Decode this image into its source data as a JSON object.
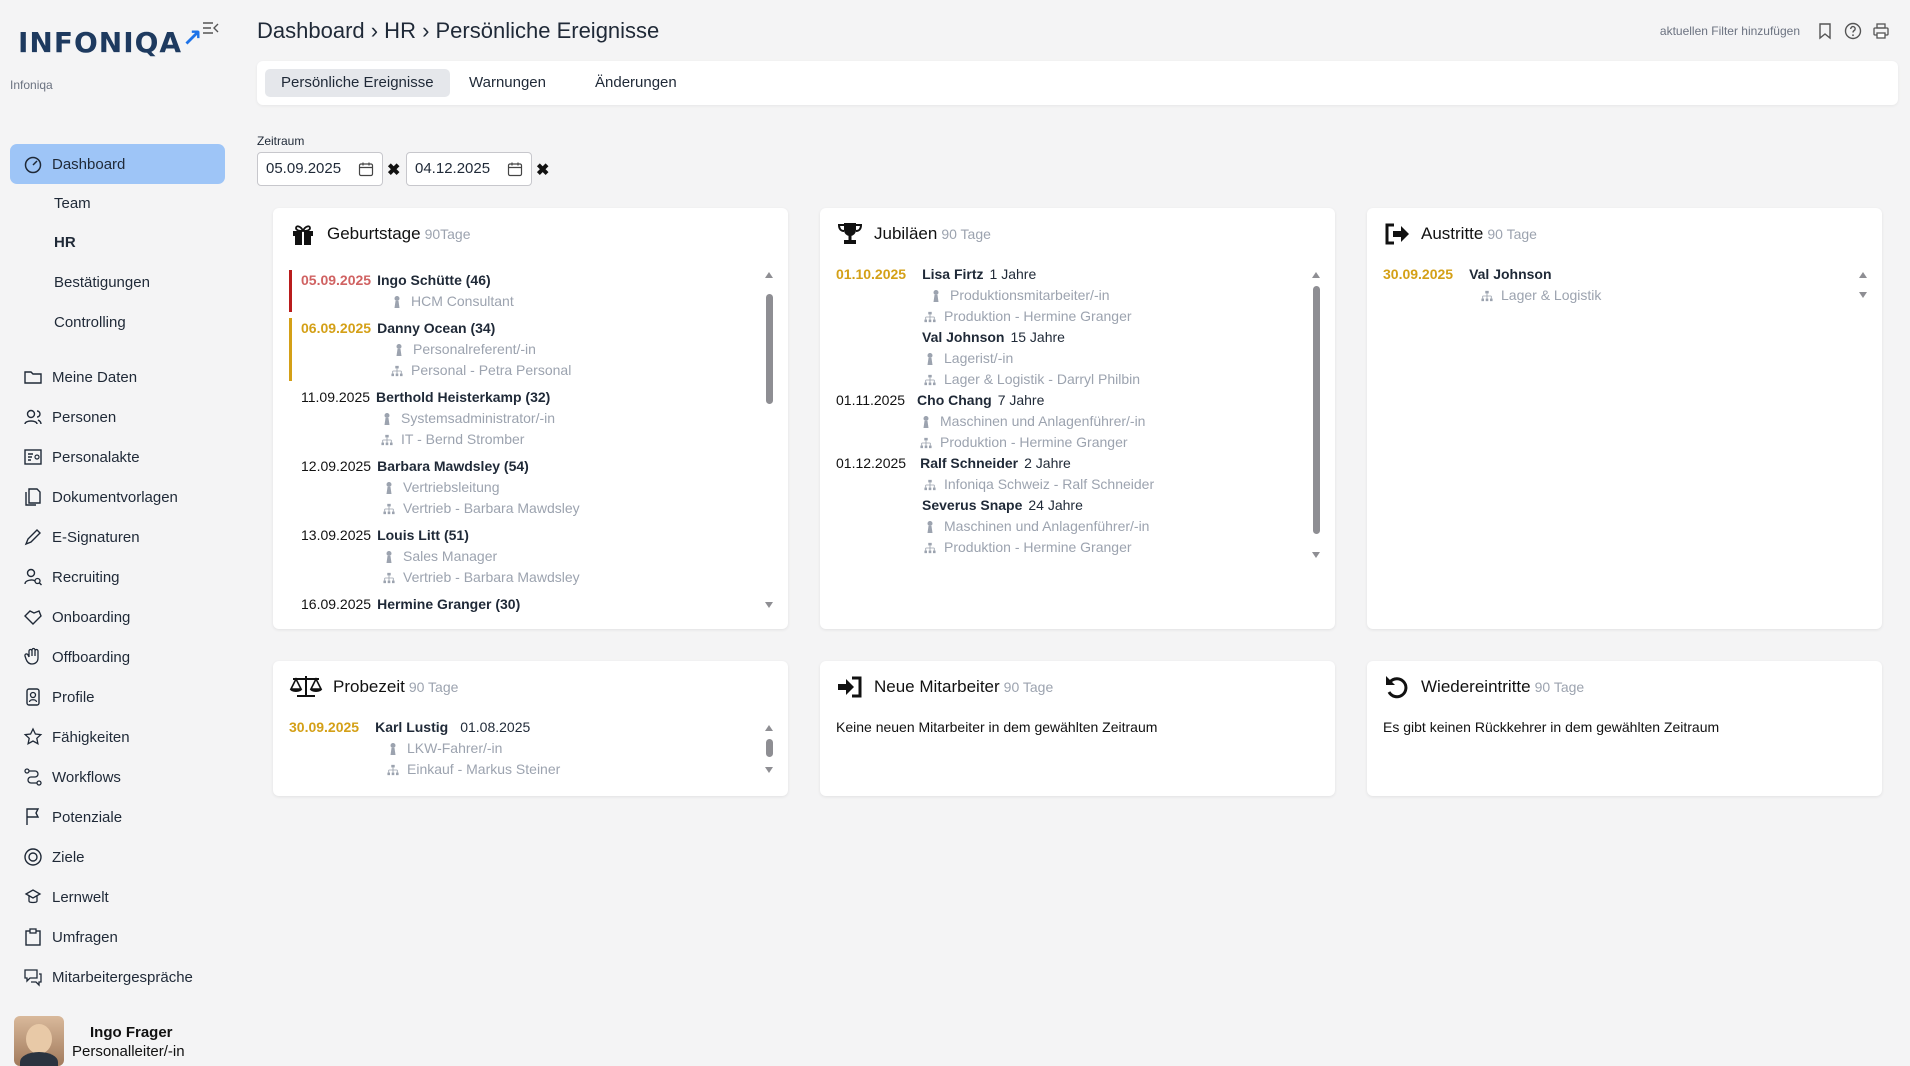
{
  "brand": {
    "logo_text": "INFONIQA",
    "tenant": "Infoniqa"
  },
  "breadcrumb": "Dashboard › HR › Persönliche Ereignisse",
  "header_actions": {
    "filter_label": "aktuellen Filter hinzufügen"
  },
  "sidebar": {
    "dashboard": "Dashboard",
    "sub": [
      "Team",
      "HR",
      "Bestätigungen",
      "Controlling"
    ],
    "items": [
      "Meine Daten",
      "Personen",
      "Personalakte",
      "Dokumentvorlagen",
      "E-Signaturen",
      "Recruiting",
      "Onboarding",
      "Offboarding",
      "Profile",
      "Fähigkeiten",
      "Workflows",
      "Potenziale",
      "Ziele",
      "Lernwelt",
      "Umfragen",
      "Mitarbeitergespräche"
    ]
  },
  "user": {
    "name": "Ingo Frager",
    "role": "Personalleiter/-in"
  },
  "tabs": [
    "Persönliche Ereignisse",
    "Warnungen",
    "Änderungen"
  ],
  "range": {
    "label": "Zeitraum",
    "from": "05.09.2025",
    "to": "04.12.2025"
  },
  "cards": {
    "birthdays": {
      "title": "Geburtstage",
      "sub": "90Tage",
      "entries": [
        {
          "date": "05.09.2025",
          "name": "Ingo Schütte (46)",
          "position": "HCM Consultant",
          "org": ""
        },
        {
          "date": "06.09.2025",
          "name": "Danny Ocean (34)",
          "position": "Personalreferent/-in",
          "org": "Personal - Petra Personal"
        },
        {
          "date": "11.09.2025",
          "name": "Berthold Heisterkamp (32)",
          "position": "Systemsadministrator/-in",
          "org": "IT - Bernd Stromber"
        },
        {
          "date": "12.09.2025",
          "name": "Barbara Mawdsley (54)",
          "position": "Vertriebsleitung",
          "org": "Vertrieb - Barbara Mawdsley"
        },
        {
          "date": "13.09.2025",
          "name": "Louis Litt (51)",
          "position": "Sales Manager",
          "org": "Vertrieb - Barbara Mawdsley"
        },
        {
          "date": "16.09.2025",
          "name": "Hermine Granger (30)",
          "position": "",
          "org": ""
        }
      ]
    },
    "jubilees": {
      "title": "Jubiläen",
      "sub": "90 Tage",
      "entries": [
        {
          "date": "01.10.2025",
          "name": "Lisa Firtz",
          "years": "1 Jahre",
          "position": "Produktionsmitarbeiter/-in",
          "org": "Produktion - Hermine Granger"
        },
        {
          "date": "",
          "name": "Val Johnson",
          "years": "15 Jahre",
          "position": "Lagerist/-in",
          "org": "Lager & Logistik - Darryl Philbin"
        },
        {
          "date": "01.11.2025",
          "name": "Cho Chang",
          "years": "7 Jahre",
          "position": "Maschinen und Anlagenführer/-in",
          "org": "Produktion - Hermine Granger"
        },
        {
          "date": "01.12.2025",
          "name": "Ralf Schneider",
          "years": "2 Jahre",
          "position": "",
          "org": "Infoniqa Schweiz - Ralf Schneider"
        },
        {
          "date": "",
          "name": "Severus Snape",
          "years": "24 Jahre",
          "position": "Maschinen und Anlagenführer/-in",
          "org": "Produktion - Hermine Granger"
        }
      ]
    },
    "exits": {
      "title": "Austritte",
      "sub": "90 Tage",
      "entries": [
        {
          "date": "30.09.2025",
          "name": "Val Johnson",
          "org": "Lager & Logistik"
        }
      ]
    },
    "probation": {
      "title": "Probezeit",
      "sub": "90 Tage",
      "entries": [
        {
          "date": "30.09.2025",
          "name": "Karl Lustig",
          "start": "01.08.2025",
          "position": "LKW-Fahrer/-in",
          "org": "Einkauf - Markus Steiner"
        }
      ]
    },
    "new_hires": {
      "title": "Neue Mitarbeiter",
      "sub": "90 Tage",
      "message": "Keine neuen Mitarbeiter in dem gewählten Zeitraum"
    },
    "rehires": {
      "title": "Wiedereintritte",
      "sub": "90 Tage",
      "message": "Es gibt keinen Rückkehrer in dem gewählten Zeitraum"
    }
  },
  "colors": {
    "accent": "#9ec5f7",
    "today": "#b91c1c",
    "soon": "#d4a017",
    "muted": "#9ca3af"
  }
}
